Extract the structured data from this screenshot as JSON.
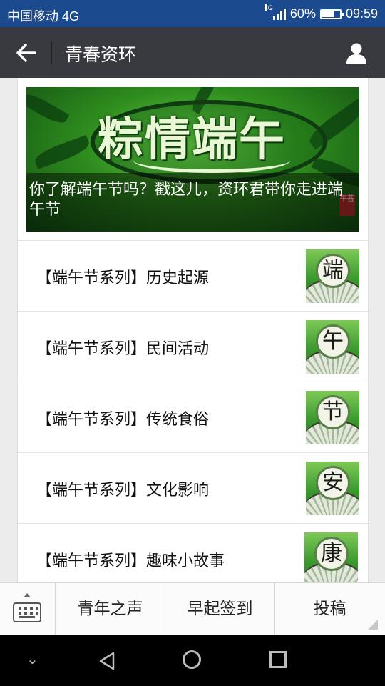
{
  "status_bar": {
    "carrier": "中国移动 4G",
    "network": "4G",
    "battery_percent": "60%",
    "battery_level": 0.6,
    "time": "09:59"
  },
  "header": {
    "title": "青春资环"
  },
  "banner": {
    "logo_text": "粽情端午",
    "seal_text": "午菩",
    "caption": "你了解端午节吗？戳这儿，资环君带你走进端午节"
  },
  "articles": [
    {
      "title": "【端午节系列】历史起源",
      "thumb_char": "端"
    },
    {
      "title": "【端午节系列】民间活动",
      "thumb_char": "午"
    },
    {
      "title": "【端午节系列】传统食俗",
      "thumb_char": "节"
    },
    {
      "title": "【端午节系列】文化影响",
      "thumb_char": "安"
    },
    {
      "title": "【端午节系列】趣味小故事",
      "thumb_char": "康"
    }
  ],
  "menu": {
    "items": [
      "青年之声",
      "早起签到",
      "投稿"
    ]
  },
  "colors": {
    "status_bar": "#1b4a8f",
    "title_bar": "#393a3f",
    "nav_bar": "#000000"
  },
  "icons": {
    "back": "arrow-left-icon",
    "profile": "user-icon",
    "keyboard": "keyboard-icon"
  }
}
